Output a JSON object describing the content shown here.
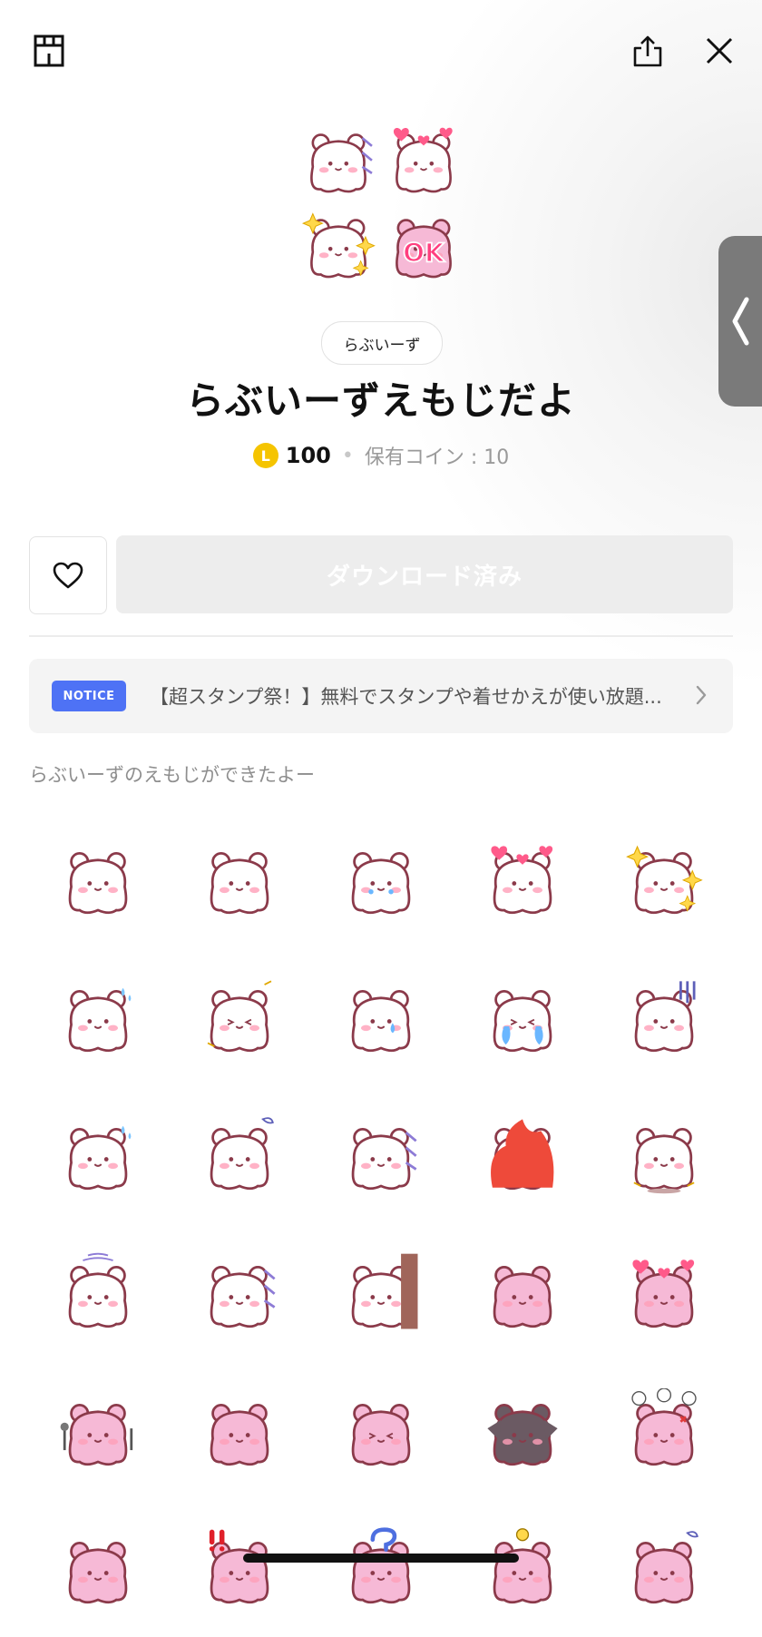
{
  "header": {
    "shop_icon": "shop-icon",
    "share_icon": "share-icon",
    "close_icon": "close-icon"
  },
  "product": {
    "author": "らぶいーず",
    "title": "らぶいーずえもじだよ",
    "coin_symbol": "L",
    "price": "100",
    "separator": "•",
    "owned_coins": "保有コイン : 10"
  },
  "actions": {
    "favorite_icon": "heart-outline-icon",
    "download_label": "ダウンロード済み"
  },
  "notice": {
    "badge": "NOTICE",
    "text": "【超スタンプ祭！】無料でスタンプや着せかえが使い放題..."
  },
  "description": "らぶいーずのえもじができたよー",
  "emoji_grid": {
    "items": [
      {
        "variant": "white",
        "decor": "none"
      },
      {
        "variant": "white",
        "decor": "blush"
      },
      {
        "variant": "white",
        "decor": "tears"
      },
      {
        "variant": "white",
        "decor": "hearts"
      },
      {
        "variant": "white",
        "decor": "sparkles"
      },
      {
        "variant": "white",
        "decor": "sweat"
      },
      {
        "variant": "white",
        "decor": "laugh"
      },
      {
        "variant": "white",
        "decor": "drop"
      },
      {
        "variant": "white",
        "decor": "cry"
      },
      {
        "variant": "white",
        "decor": "gloom"
      },
      {
        "variant": "white",
        "decor": "sweat"
      },
      {
        "variant": "white",
        "decor": "dizzy"
      },
      {
        "variant": "white",
        "decor": "wind"
      },
      {
        "variant": "white",
        "decor": "fire"
      },
      {
        "variant": "white",
        "decor": "jump"
      },
      {
        "variant": "white",
        "decor": "shake"
      },
      {
        "variant": "white",
        "decor": "wind"
      },
      {
        "variant": "white",
        "decor": "door"
      },
      {
        "variant": "pink",
        "decor": "none"
      },
      {
        "variant": "pink",
        "decor": "hearts"
      },
      {
        "variant": "pink",
        "decor": "fork"
      },
      {
        "variant": "pink",
        "decor": "blush"
      },
      {
        "variant": "pink",
        "decor": "squeeze"
      },
      {
        "variant": "dark",
        "decor": "devil"
      },
      {
        "variant": "pink",
        "decor": "angry"
      },
      {
        "variant": "pink",
        "decor": "none"
      },
      {
        "variant": "pink",
        "decor": "exclaim"
      },
      {
        "variant": "pink",
        "decor": "question"
      },
      {
        "variant": "pink",
        "decor": "idea"
      },
      {
        "variant": "pink",
        "decor": "dizzy"
      }
    ]
  },
  "colors": {
    "outline": "#8b3a4a",
    "white_fill": "#ffffff",
    "pink_fill": "#f6b9d6",
    "dark_fill": "#6b5a63",
    "blush": "#ff9fb8",
    "heart": "#ff5a8a",
    "notice_badge": "#4e72f5",
    "coin": "#f5c400"
  }
}
